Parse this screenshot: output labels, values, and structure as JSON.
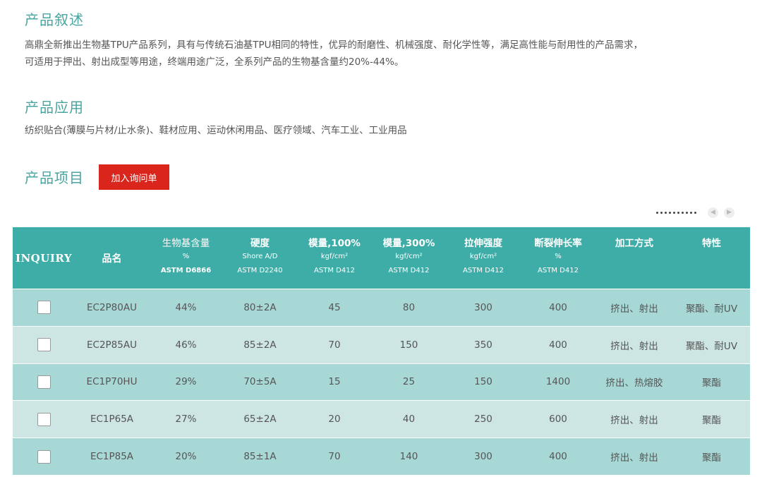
{
  "overview": {
    "title": "产品叙述",
    "line1": "高鼎全新推出生物基TPU产品系列，具有与传统石油基TPU相同的特性，优异的耐磨性、机械强度、耐化学性等，满足高性能与耐用性的产品需求，",
    "line2": "可适用于押出、射出成型等用途，终端用途广泛，全系列产品的生物基含量约20%-44%。"
  },
  "applications": {
    "title": "产品应用",
    "text": "纺织贴合(薄膜与片材/止水条)、鞋材应用、运动休闲用品、医疗领域、汽车工业、工业用品"
  },
  "items": {
    "title": "产品项目",
    "inquiry_button": "加入询问单"
  },
  "pager": {
    "dot_count": 10,
    "prev_icon": "chevron-left-icon",
    "next_icon": "chevron-right-icon"
  },
  "table": {
    "headers": {
      "inquiry": "INQUIRY",
      "name": "品名",
      "bio": {
        "main": "生物基含量",
        "unit": "%",
        "std": "ASTM D6866"
      },
      "hardness": {
        "main": "硬度",
        "unit": "Shore A/D",
        "std": "ASTM D2240"
      },
      "mod100": {
        "main": "模量,100%",
        "unit": "kgf/cm²",
        "std": "ASTM D412"
      },
      "mod300": {
        "main": "模量,300%",
        "unit": "kgf/cm²",
        "std": "ASTM D412"
      },
      "tensile": {
        "main": "拉伸强度",
        "unit": "kgf/cm²",
        "std": "ASTM D412"
      },
      "elongation": {
        "main": "断裂伸长率",
        "unit": "%",
        "std": "ASTM D412"
      },
      "process": "加工方式",
      "features": "特性"
    },
    "rows": [
      {
        "name": "EC2P80AU",
        "bio": "44%",
        "hardness": "80±2A",
        "mod100": "45",
        "mod300": "80",
        "tensile": "300",
        "elongation": "400",
        "process": "挤出、射出",
        "features": "聚酯、耐UV"
      },
      {
        "name": "EC2P85AU",
        "bio": "46%",
        "hardness": "85±2A",
        "mod100": "70",
        "mod300": "150",
        "tensile": "350",
        "elongation": "400",
        "process": "挤出、射出",
        "features": "聚酯、耐UV"
      },
      {
        "name": "EC1P70HU",
        "bio": "29%",
        "hardness": "70±5A",
        "mod100": "15",
        "mod300": "25",
        "tensile": "150",
        "elongation": "1400",
        "process": "挤出、热熔胶",
        "features": "聚酯"
      },
      {
        "name": "EC1P65A",
        "bio": "27%",
        "hardness": "65±2A",
        "mod100": "20",
        "mod300": "40",
        "tensile": "250",
        "elongation": "600",
        "process": "挤出、射出",
        "features": "聚酯"
      },
      {
        "name": "EC1P85A",
        "bio": "20%",
        "hardness": "85±1A",
        "mod100": "70",
        "mod300": "140",
        "tensile": "300",
        "elongation": "400",
        "process": "挤出、射出",
        "features": "聚酯"
      }
    ]
  },
  "colors": {
    "accent": "#4aa5a0",
    "header_bg": "#3fada7",
    "row_odd": "#a8d8d5",
    "row_even": "#cde5e3",
    "button": "#d9251c"
  }
}
